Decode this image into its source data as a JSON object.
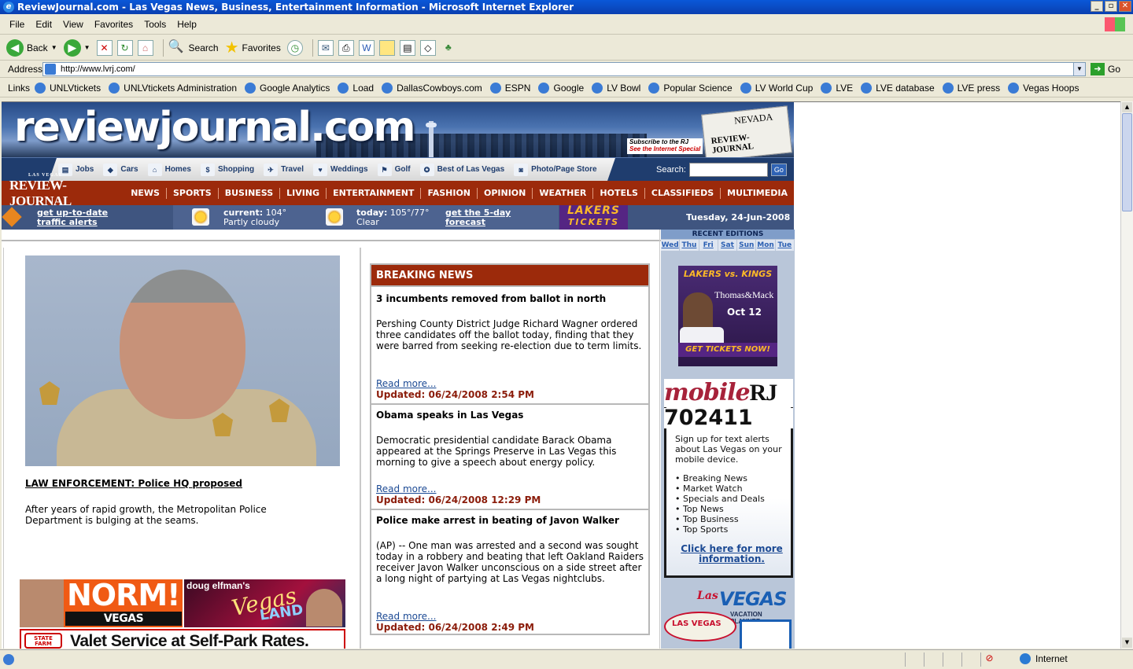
{
  "window": {
    "title": "ReviewJournal.com - Las Vegas News, Business, Entertainment Information - Microsoft Internet Explorer"
  },
  "menu": [
    "File",
    "Edit",
    "View",
    "Favorites",
    "Tools",
    "Help"
  ],
  "toolbar": {
    "back": "Back",
    "search": "Search",
    "favorites": "Favorites"
  },
  "address": {
    "label": "Address",
    "url": "http://www.lvrj.com/",
    "go": "Go"
  },
  "links": {
    "label": "Links",
    "items": [
      "UNLVtickets",
      "UNLVtickets Administration",
      "Google Analytics",
      "Load",
      "DallasCowboys.com",
      "ESPN",
      "Google",
      "LV Bowl",
      "Popular Science",
      "LV World Cup",
      "LVE",
      "LVE database",
      "LVE press",
      "Vegas Hoops"
    ]
  },
  "status": {
    "zone": "Internet"
  },
  "site": {
    "logo": "reviewjournal.com",
    "subscribe_line1": "Subscribe to the RJ",
    "subscribe_line2": "See the Internet Special",
    "paper_nevada": "NEVADA",
    "paper_name": "REVIEW-JOURNAL"
  },
  "util_nav": {
    "items": [
      {
        "label": "Jobs",
        "icon": "newspaper-icon"
      },
      {
        "label": "Cars",
        "icon": "car-icon"
      },
      {
        "label": "Homes",
        "icon": "house-icon"
      },
      {
        "label": "Shopping",
        "icon": "sale-tag-icon"
      },
      {
        "label": "Travel",
        "icon": "airplane-icon"
      },
      {
        "label": "Weddings",
        "icon": "wedding-icon"
      },
      {
        "label": "Golf",
        "icon": "golf-flag-icon"
      },
      {
        "label": "Best of Las Vegas",
        "icon": "medal-icon"
      },
      {
        "label": "Photo/Page Store",
        "icon": "camera-icon"
      }
    ],
    "search_label": "Search:",
    "search_go": "Go"
  },
  "main_nav": {
    "brand_small": "LAS VEGAS",
    "brand": "REVIEW-JOURNAL",
    "items": [
      "NEWS",
      "SPORTS",
      "BUSINESS",
      "LIVING",
      "ENTERTAINMENT",
      "FASHION",
      "OPINION",
      "WEATHER",
      "HOTELS",
      "CLASSIFIEDS",
      "MULTIMEDIA"
    ]
  },
  "info_strip": {
    "traffic_line1": "get up-to-date",
    "traffic_line2": "traffic alerts",
    "current_label": "current:",
    "current_temp": "104°",
    "current_cond": "Partly cloudy",
    "today_label": "today:",
    "today_temp": "105°/77°",
    "today_cond": "Clear",
    "forecast_line1": "get the 5-day",
    "forecast_line2": "forecast",
    "lakers_line1": "LAKERS",
    "lakers_line2": "TICKETS",
    "date": "Tuesday, 24-Jun-2008"
  },
  "lead": {
    "headline": "LAW ENFORCEMENT: Police HQ proposed",
    "summary": "After years of rapid growth, the Metropolitan Police Department is bulging at the seams."
  },
  "ads": {
    "norm_big": "NORM!",
    "norm_small": "VEGAS CONFIDENTIAL",
    "elfman_name": "doug elfman's",
    "elfman_vegas": "Vegas",
    "elfman_land": "LAND",
    "valet_brand": "STATE FARM",
    "valet_text": "Valet Service at Self-Park Rates."
  },
  "breaking": {
    "header": "BREAKING NEWS",
    "items": [
      {
        "title": "3 incumbents removed from ballot in north",
        "body": "Pershing County District Judge Richard Wagner ordered three candidates off the ballot today, finding that they were barred from seeking re-election due to term limits.",
        "more": "Read more...",
        "updated": "Updated: 06/24/2008 2:54 PM"
      },
      {
        "title": "Obama speaks in Las Vegas",
        "body": "Democratic presidential candidate Barack Obama appeared at the Springs Preserve in Las Vegas this morning to give a speech about energy policy.",
        "more": "Read more...",
        "updated": "Updated: 06/24/2008 12:29 PM"
      },
      {
        "title": "Police make arrest in beating of Javon Walker",
        "body": "(AP) -- One man was arrested and a second was sought today in a robbery and beating that left Oakland Raiders receiver Javon Walker unconscious on a side street after a long night of partying at Las Vegas nightclubs.",
        "more": "Read more...",
        "updated": "Updated: 06/24/2008 2:49 PM"
      }
    ]
  },
  "right": {
    "recent_title": "RECENT EDITIONS",
    "days": [
      "Wed",
      "Thu",
      "Fri",
      "Sat",
      "Sun",
      "Mon",
      "Tue"
    ],
    "lakers_ad": {
      "title": "LAKERS vs. KINGS",
      "venue": "Thomas&Mack",
      "date": "Oct 12",
      "cta": "GET TICKETS NOW!"
    },
    "mobile": {
      "logo": "mobile",
      "logo_rj": "RJ",
      "number": "702411",
      "intro": "Sign up for text alerts about Las Vegas on your mobile device.",
      "list": [
        "Breaking News",
        "Market Watch",
        "Specials and Deals",
        "Top News",
        "Top Business",
        "Top Sports"
      ],
      "link": "Click here for more information."
    },
    "lv_ad": {
      "las": "Las",
      "vegas": "VEGAS",
      "planner": "VACATION PLANNER",
      "sign": "LAS VEGAS"
    }
  }
}
